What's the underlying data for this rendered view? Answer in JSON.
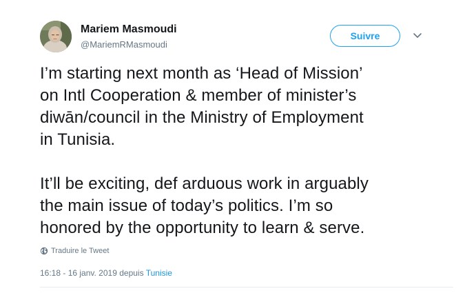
{
  "user": {
    "name": "Mariem Masmoudi",
    "handle": "@MariemRMasmoudi",
    "avatar": "profile-photo"
  },
  "follow_button": {
    "label": "Suivre"
  },
  "menu": {
    "icon": "chevron-down-icon"
  },
  "tweet": {
    "paragraphs": [
      "I’m starting next month as ‘Head of Mission’\non Intl Cooperation & member of minister’s\ndiwān/council in the Ministry of Employment\nin Tunisia.",
      "It’ll be exciting, def arduous work in arguably\nthe main issue of today’s politics. I’m so\nhonored by the opportunity to learn & serve."
    ]
  },
  "translate": {
    "label": "Traduire le Tweet",
    "icon": "globe-icon"
  },
  "meta": {
    "timestamp": "16:18 - 16 janv. 2019",
    "via": "depuis",
    "location": "Tunisie"
  },
  "colors": {
    "accent": "#1da1f2",
    "link": "#1b95e0",
    "text": "#14171a",
    "muted": "#657786",
    "divider": "#e6ecf0"
  }
}
